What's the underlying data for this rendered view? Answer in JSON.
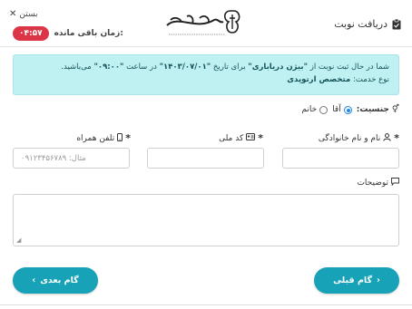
{
  "header": {
    "title": "دریافت نوبت",
    "close_label": "بستن",
    "timer_label": "زمان باقی مانده:",
    "timer_value": "۰۴:۵۷",
    "logo_name": "همراه مشاور",
    "logo_tagline": "بزرگترین سامانه مشاوره تلفنی کشور"
  },
  "alert": {
    "line1_prefix": "شما در حال ثبت نوبت از",
    "doctor_name": "\"بیژن دریاباری\"",
    "line1_mid1": "برای تاریخ",
    "date": "\"۱۴۰۳/۰۷/۰۱\"",
    "line1_mid2": "در ساعت",
    "time": "\"۰۹:۰۰\"",
    "line1_suffix": "می‌باشید.",
    "service_label": "نوع خدمت:",
    "service_value": "متخصص ارتوپدی"
  },
  "form": {
    "gender_label": "جنسیت:",
    "gender_male": "آقا",
    "gender_female": "خانم",
    "gender_selected": "male",
    "name_label": "نام و نام خانوادگی",
    "nid_label": "کد ملی",
    "phone_label": "تلفن همراه",
    "phone_placeholder": "مثال: ۰۹۱۲۳۴۵۶۷۸۹",
    "desc_label": "توضیحات"
  },
  "buttons": {
    "next_label": "گام بعدی",
    "prev_label": "گام قبلی"
  },
  "colors": {
    "accent": "#17a2b8",
    "timer": "#dc3545",
    "alert_bg": "#bff0f2"
  }
}
